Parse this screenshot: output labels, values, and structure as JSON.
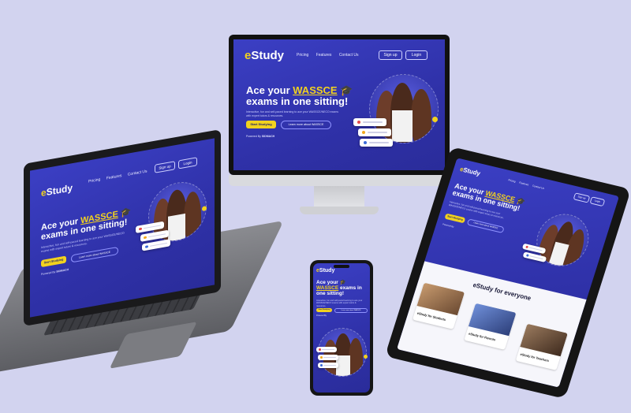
{
  "site": {
    "logo": "Study",
    "logo_mark": "e",
    "nav": {
      "pricing": "Pricing",
      "features": "Features",
      "contact": "Contact Us"
    },
    "signup": "Sign up",
    "login": "Login",
    "headline_pre": "Ace your ",
    "headline_word": "WASSCE",
    "headline_post": "exams in one sitting!",
    "subtext": "Interactive, fun and self-paced learning to ace your WASSCE/NECO exams with expert tutors & resources.",
    "cta_primary": "Start Studying",
    "cta_secondary": "Learn more about WASSCE",
    "powered_by": "Powered By",
    "everyone_title": "eStudy for everyone",
    "feature_students": "eStudy for Students",
    "feature_parents": "eStudy for Parents",
    "feature_teachers": "eStudy for Teachers"
  },
  "colors": {
    "background": "#d2d3ef",
    "brand_blue": "#3b3fc4",
    "accent_yellow": "#f2d21e"
  }
}
